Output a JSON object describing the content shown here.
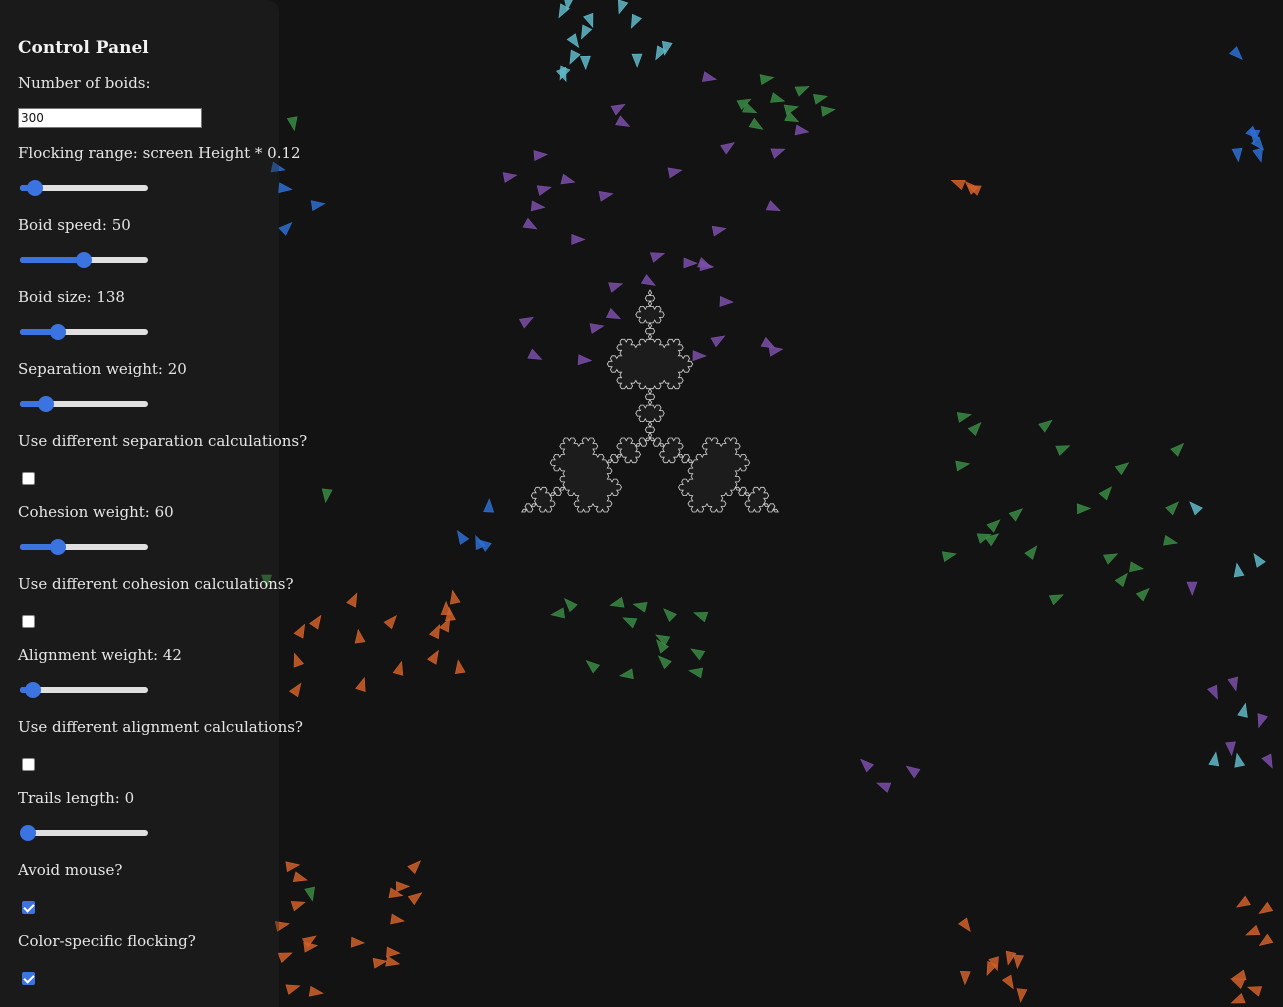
{
  "colors": {
    "background": "#131313",
    "accent": "#3b73e0",
    "boid_purple": "#7b4fa8",
    "boid_green": "#3a8a45",
    "boid_cyan": "#5fb8c8",
    "boid_blue": "#2e6fd0",
    "boid_orange": "#d0602a",
    "snowflake": "#d8d8d8"
  },
  "panel": {
    "title": "Control Panel",
    "num_boids_label": "Number of boids:",
    "num_boids_value": "300",
    "flocking_range_label": "Flocking range: screen Height * 0.12",
    "flocking_range_fraction": 0.12,
    "boid_speed_label": "Boid speed: 50",
    "boid_speed_fraction": 0.5,
    "boid_size_label": "Boid size: 138",
    "boid_size_fraction": 0.3,
    "separation_label": "Separation weight: 20",
    "separation_fraction": 0.2,
    "separation_alt_label": "Use different separation calculations?",
    "separation_alt_checked": false,
    "cohesion_label": "Cohesion weight: 60",
    "cohesion_fraction": 0.3,
    "cohesion_alt_label": "Use different cohesion calculations?",
    "cohesion_alt_checked": false,
    "alignment_label": "Alignment weight: 42",
    "alignment_fraction": 0.1,
    "alignment_alt_label": "Use different alignment calculations?",
    "alignment_alt_checked": false,
    "trails_label": "Trails length: 0",
    "trails_fraction": 0,
    "avoid_mouse_label": "Avoid mouse?",
    "avoid_mouse_checked": true,
    "color_flocking_label": "Color-specific flocking?",
    "color_flocking_checked": true
  }
}
